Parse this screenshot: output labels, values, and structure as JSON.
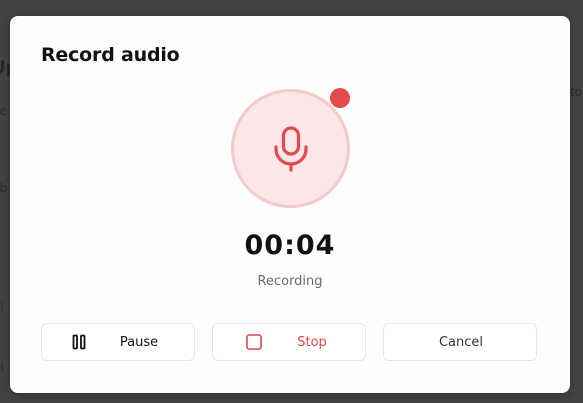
{
  "underlying_page": {
    "heading": "Up",
    "line1": "p",
    "line2": "he",
    "line_right": "to",
    "line3": "ub",
    "line4": "di",
    "line5": "di"
  },
  "modal": {
    "title": "Record audio",
    "mic_icon": "microphone-icon",
    "recording_indicator_color": "#e5484d",
    "timer": "00:04",
    "status": "Recording",
    "buttons": {
      "pause": {
        "label": "Pause",
        "icon": "pause-icon"
      },
      "stop": {
        "label": "Stop",
        "icon": "stop-square-icon",
        "color": "#e0474c"
      },
      "cancel": {
        "label": "Cancel"
      }
    }
  },
  "colors": {
    "accent": "#e5484d",
    "mic_background": "#fbe7e7",
    "mic_ring": "#f3c9c9",
    "overlay": "#434343"
  }
}
